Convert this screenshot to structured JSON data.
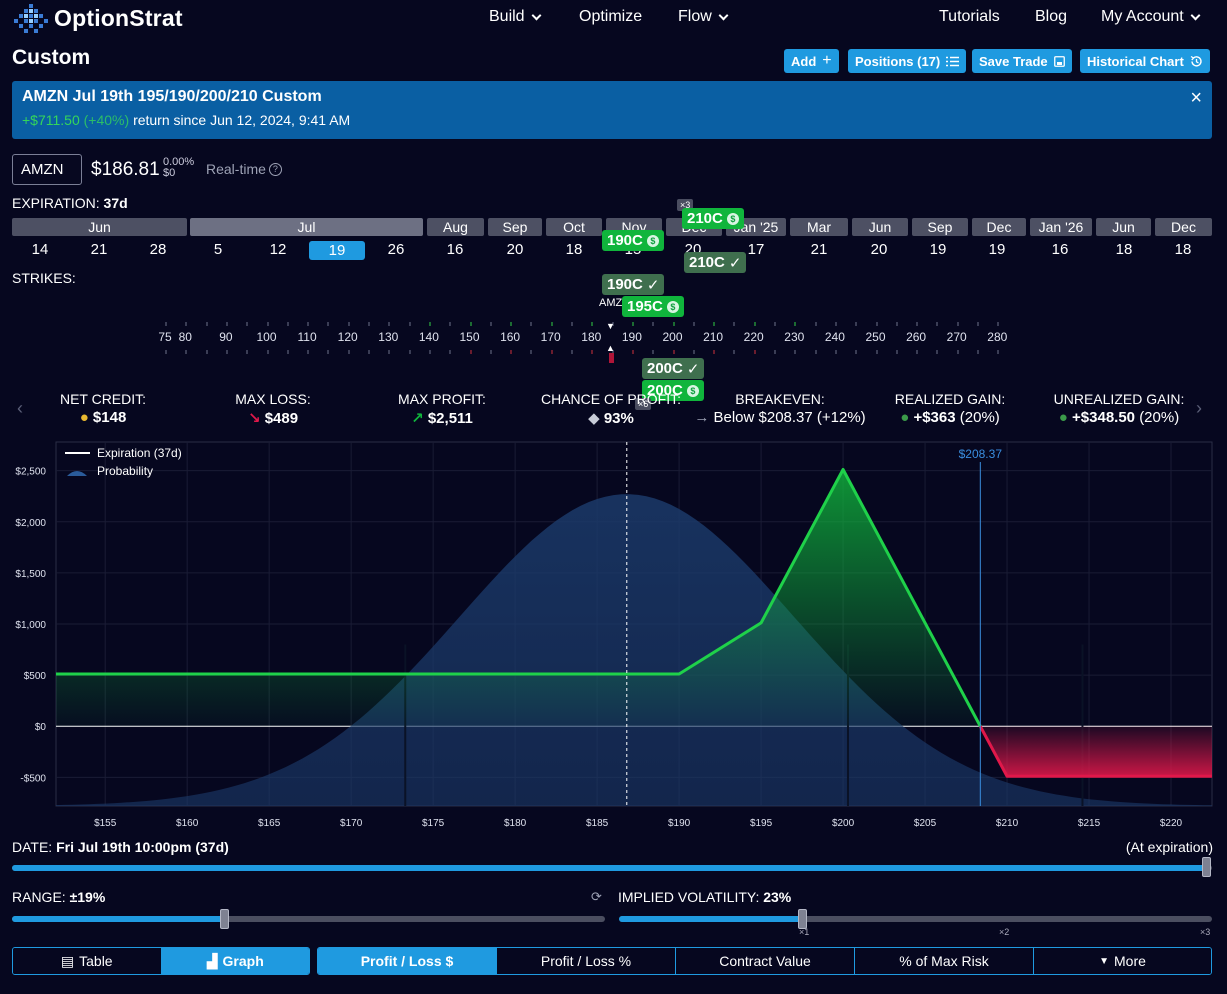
{
  "brand": {
    "name": "OptionStrat"
  },
  "nav": {
    "build": "Build",
    "optimize": "Optimize",
    "flow": "Flow",
    "tutorials": "Tutorials",
    "blog": "Blog",
    "account": "My Account"
  },
  "page": {
    "title": "Custom"
  },
  "toolbar": {
    "add": "Add",
    "positions": "Positions (17)",
    "save": "Save Trade",
    "history": "Historical Chart"
  },
  "banner": {
    "title": "AMZN Jul 19th 195/190/200/210 Custom",
    "gain": "+$711.50",
    "gain_pct": "(+40%)",
    "rest": "return since Jun 12, 2024, 9:41 AM"
  },
  "ticker": {
    "symbol": "AMZN",
    "price": "$186.81",
    "change_pct": "0.00%",
    "change_abs": "$0",
    "realtime": "Real-time"
  },
  "expiration": {
    "label": "EXPIRATION:",
    "value": "37d",
    "months": [
      "Jun",
      "Jul",
      "Aug",
      "Sep",
      "Oct",
      "Nov",
      "Dec",
      "Jan '25",
      "Mar",
      "Jun",
      "Sep",
      "Dec",
      "Jan '26",
      "Jun",
      "Dec"
    ],
    "days": [
      "14",
      "21",
      "28",
      "5",
      "12",
      "19",
      "26",
      "16",
      "20",
      "18",
      "15",
      "20",
      "17",
      "21",
      "20",
      "19",
      "19",
      "16",
      "18",
      "18"
    ]
  },
  "strikes": {
    "label": "STRIKES:",
    "values": [
      "75",
      "80",
      "90",
      "100",
      "110",
      "120",
      "130",
      "140",
      "150",
      "160",
      "170",
      "180",
      "190",
      "200",
      "210",
      "220",
      "230",
      "240",
      "250",
      "260",
      "270",
      "280"
    ],
    "underlying": "AMZN"
  },
  "legs": {
    "tag_190c_a": "190C",
    "tag_210c_a": "210C",
    "tag_210c_b": "210C",
    "tag_190c_b": "190C",
    "tag_195c": "195C",
    "tag_200c_a": "200C",
    "tag_200c_b": "200C",
    "badge_x3": "×3",
    "badge_x6": "×6"
  },
  "stats": {
    "net_credit": {
      "label": "NET CREDIT:",
      "value": "$148"
    },
    "max_loss": {
      "label": "MAX LOSS:",
      "value": "$489"
    },
    "max_profit": {
      "label": "MAX PROFIT:",
      "value": "$2,511"
    },
    "chance": {
      "label": "CHANCE OF PROFIT:",
      "value": "93%"
    },
    "breakeven": {
      "label": "BREAKEVEN:",
      "value": "Below $208.37 (+12%)"
    },
    "realized": {
      "label": "REALIZED GAIN:",
      "value": "+$363",
      "pct": "(20%)"
    },
    "unrealized": {
      "label": "UNREALIZED GAIN:",
      "value": "+$348.50",
      "pct": "(20%)"
    }
  },
  "chart_data": {
    "type": "line",
    "title": "",
    "xlabel": "",
    "ylabel": "",
    "legend": [
      "Expiration (37d)",
      "Probability"
    ],
    "legend_placement": "top-left",
    "xlim": [
      152,
      222.5
    ],
    "ylim": [
      -780,
      2780
    ],
    "x_ticks": [
      155,
      160,
      165,
      170,
      175,
      180,
      185,
      190,
      195,
      200,
      205,
      210,
      215,
      220
    ],
    "y_ticks": [
      2500,
      2000,
      1500,
      1000,
      500,
      0,
      -500
    ],
    "series": [
      {
        "name": "Expiration (37d)",
        "x": [
          152,
          190,
          195,
          200,
          208.37,
          210,
          222.5
        ],
        "y": [
          511,
          511,
          1011,
          2511,
          0,
          -489,
          -489
        ]
      }
    ],
    "probability_curve": {
      "mean": 186.81,
      "sd": 10.2,
      "peak_y": 2270
    },
    "current_price": 186.81,
    "breakeven": 208.37,
    "breakeven_label": "$208.37",
    "grid": true
  },
  "date_control": {
    "label": "DATE:",
    "value": "Fri Jul 19th 10:00pm (37d)",
    "right": "(At expiration)",
    "progress": 1.0
  },
  "range_control": {
    "label": "RANGE:",
    "value": "±19%",
    "level": 0.36
  },
  "iv_control": {
    "label": "IMPLIED VOLATILITY:",
    "value": "23%",
    "level": 0.31,
    "marks": [
      "×1",
      "×2",
      "×3"
    ]
  },
  "view_tabs": {
    "table": "Table",
    "graph": "Graph"
  },
  "metric_tabs": {
    "pl_dollar": "Profit / Loss $",
    "pl_pct": "Profit / Loss %",
    "contract": "Contract Value",
    "max_risk": "% of Max Risk",
    "more": "More"
  },
  "colors": {
    "accent": "#1f9ae0",
    "profit": "#10b53c",
    "loss": "#e0184a",
    "background": "#06071f"
  }
}
